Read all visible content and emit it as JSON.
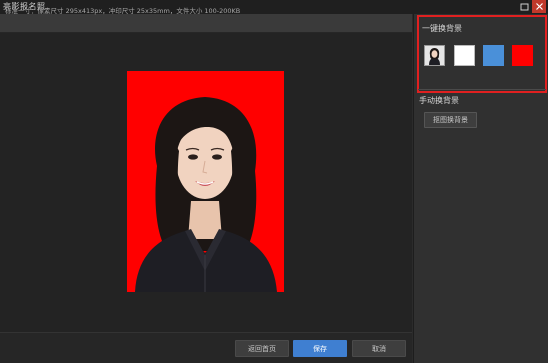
{
  "window": {
    "title": "亮影报名照",
    "maximize_icon": "maximize-icon",
    "close_icon": "close-icon"
  },
  "info": {
    "text": "标准一寸：像素尺寸 295x413px，冲印尺寸 25x35mm，文件大小 100-200KB"
  },
  "photo": {
    "background_color": "#ff0000",
    "alt": "portrait"
  },
  "right_panel": {
    "one_click_title": "一键换背景",
    "swatches": [
      {
        "name": "original-photo",
        "color": "#e6e6e6"
      },
      {
        "name": "white",
        "color": "#ffffff"
      },
      {
        "name": "blue",
        "color": "#4a90d9"
      },
      {
        "name": "red",
        "color": "#ff0000"
      }
    ],
    "highlight_color": "#e02020",
    "manual_title": "手动换背景",
    "manual_button": "抠图换背景"
  },
  "footer": {
    "back_label": "返回首页",
    "save_label": "保存",
    "cancel_label": "取消"
  }
}
